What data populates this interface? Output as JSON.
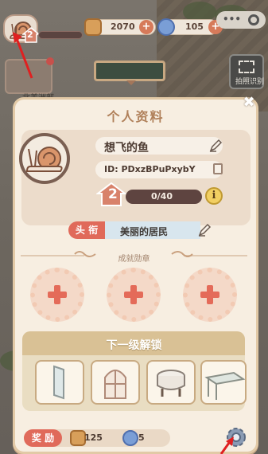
{
  "hud": {
    "level": "2",
    "coins": "2070",
    "gems": "105",
    "building_label": "北美洲部",
    "scan_label": "拍照识别"
  },
  "profile": {
    "title": "个人资料",
    "name": "想飞的鱼",
    "id_text": "ID: PDxzBPuPxybY",
    "level": "2",
    "xp_text": "0/40",
    "title_label": "头 衔",
    "title_value": "美丽的居民",
    "achievements_label": "成就勋章"
  },
  "unlock": {
    "title": "下一级解锁",
    "items": [
      "mirror-item",
      "arched-window-item",
      "stool-item",
      "table-item"
    ]
  },
  "reward": {
    "label": "奖 励",
    "coins": "125",
    "gems": "5"
  },
  "colors": {
    "panel_bg": "#f7eee1",
    "accent_red": "#e06a5a",
    "title_brown": "#b0805a",
    "arrow_red": "#e02020"
  }
}
